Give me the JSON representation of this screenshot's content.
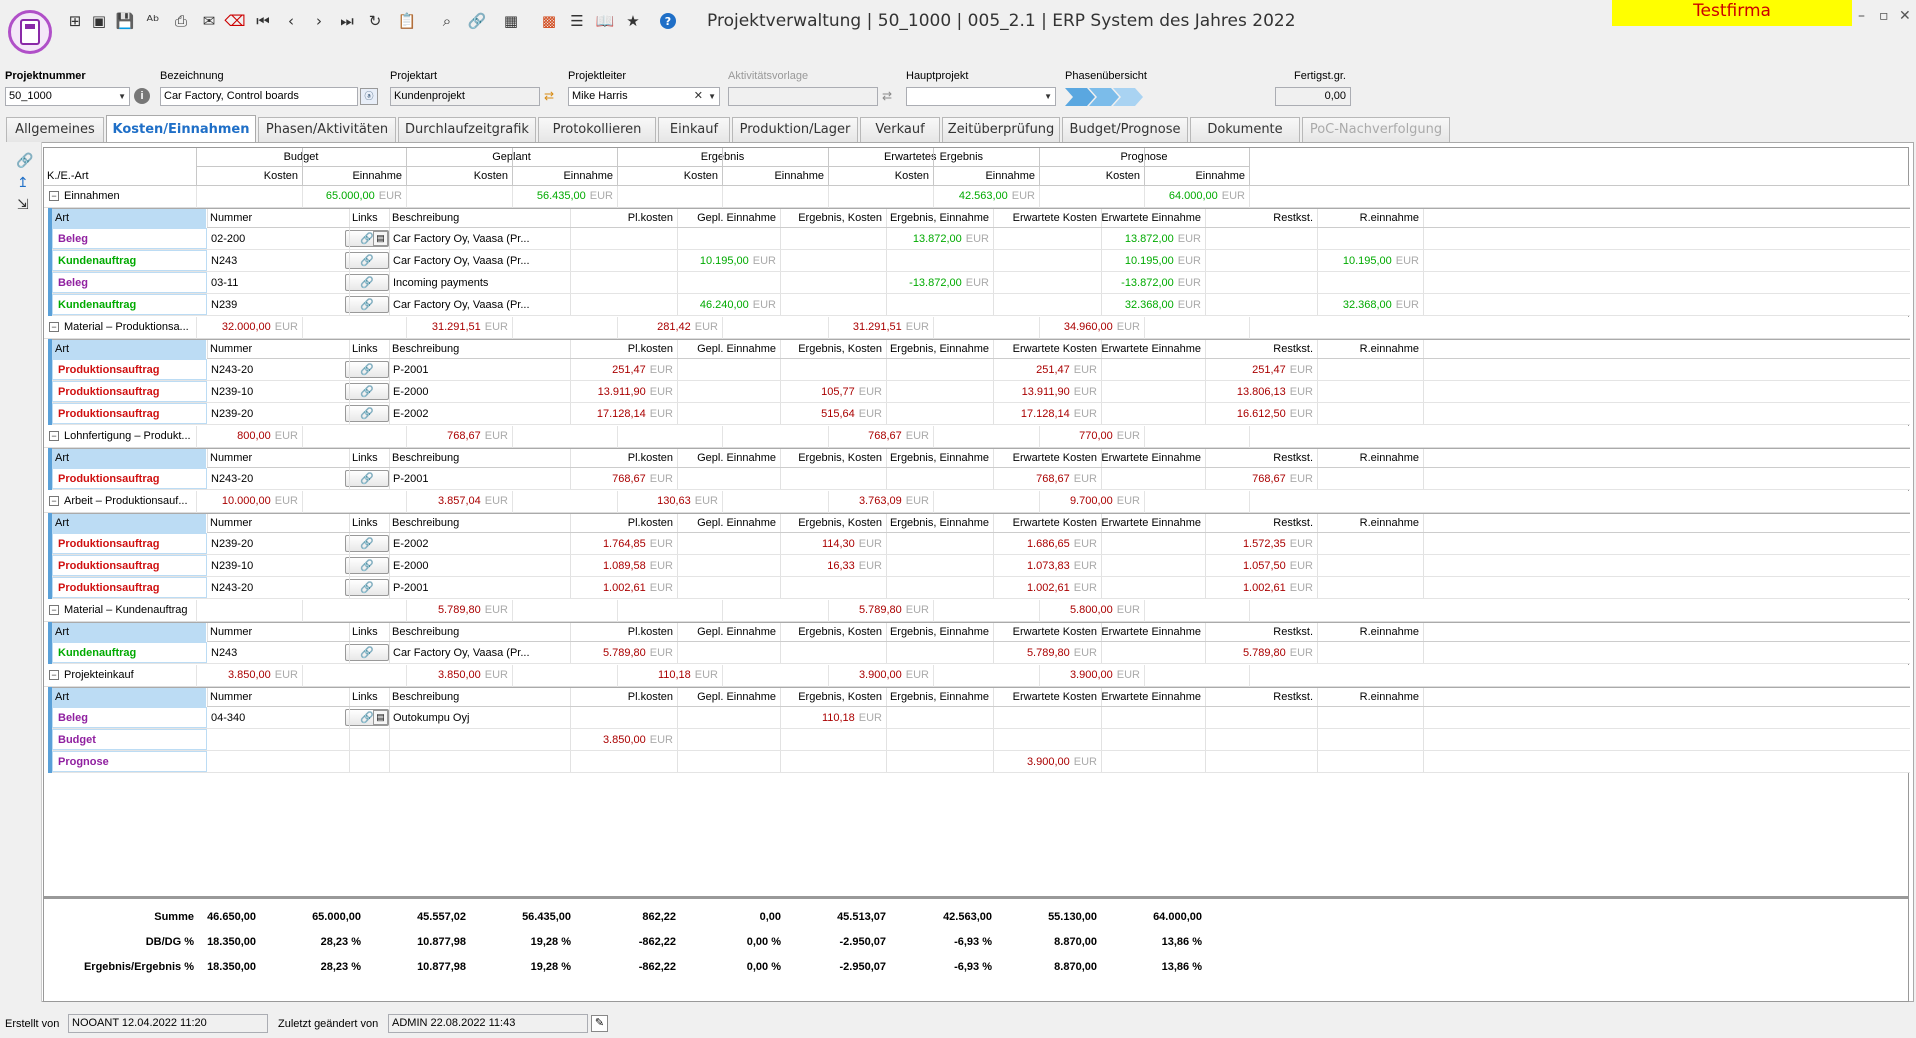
{
  "window": {
    "title": "Projektverwaltung | 50_1000 | 005_2.1 | ERP System des Jahres 2022",
    "company": "Testfirma"
  },
  "toolbar": [
    "new-icon",
    "save-disabled-icon",
    "save-icon",
    "spellcheck-icon",
    "print-icon",
    "mail-icon",
    "delete-icon",
    "first-icon",
    "prev-icon",
    "next-icon",
    "last-icon",
    "refresh-icon",
    "clipboard-icon",
    "search-icon",
    "link-icon",
    "grid-icon",
    "apps-icon",
    "list-icon",
    "book-icon",
    "star-icon",
    "help-icon"
  ],
  "fields": {
    "projektnummer": {
      "label": "Projektnummer",
      "value": "50_1000"
    },
    "bezeichnung": {
      "label": "Bezeichnung",
      "value": "Car Factory, Control boards"
    },
    "projektart": {
      "label": "Projektart",
      "value": "Kundenprojekt"
    },
    "projektleiter": {
      "label": "Projektleiter",
      "value": "Mike Harris"
    },
    "aktivitaetsvorlage": {
      "label": "Aktivitätsvorlage",
      "value": ""
    },
    "hauptprojekt": {
      "label": "Hauptprojekt",
      "value": ""
    },
    "phasenuebersicht": {
      "label": "Phasenübersicht"
    },
    "fertigst": {
      "label": "Fertigst.gr.",
      "value": "0,00"
    }
  },
  "tabs": [
    "Allgemeines",
    "Kosten/Einnahmen",
    "Phasen/Aktivitäten",
    "Durchlaufzeitgrafik",
    "Protokollieren",
    "Einkauf",
    "Produktion/Lager",
    "Verkauf",
    "Zeitüberprüfung",
    "Budget/Prognose",
    "Dokumente",
    "PoC-Nachverfolgung"
  ],
  "grid": {
    "col_kea": "K./E.-Art",
    "groups_hdr": [
      "Budget",
      "Geplant",
      "Ergebnis",
      "Erwartetes Ergebnis",
      "Prognose"
    ],
    "kosten": "Kosten",
    "einnahme": "Einnahme",
    "eur": "EUR",
    "sub_headers": [
      "Art",
      "Nummer",
      "Links",
      "Beschreibung",
      "Pl.kosten",
      "Gepl. Einnahme",
      "Ergebnis, Kosten",
      "Ergebnis, Einnahme",
      "Erwartete Kosten",
      "Erwartete Einnahme",
      "Restkst.",
      "R.einnahme"
    ],
    "sections": [
      {
        "name": "Einnahmen",
        "vals": [
          "",
          "65.000,00",
          "",
          "56.435,00",
          "",
          "",
          "",
          "42.563,00",
          "",
          "64.000,00"
        ],
        "rows": [
          {
            "art": "Beleg",
            "cls": "pur",
            "nr": "02-200",
            "doc": true,
            "desc": "Car Factory Oy, Vaasa (Pr...",
            "v": [
              "",
              "",
              "",
              "13.872,00",
              "",
              "13.872,00",
              "",
              ""
            ],
            "vc": "grn"
          },
          {
            "art": "Kundenauftrag",
            "cls": "grn",
            "nr": "N243",
            "doc": false,
            "desc": "Car Factory Oy, Vaasa (Pr...",
            "v": [
              "",
              "10.195,00",
              "",
              "",
              "",
              "10.195,00",
              "",
              "10.195,00"
            ],
            "vc": "grn"
          },
          {
            "art": "Beleg",
            "cls": "pur",
            "nr": "03-11",
            "doc": false,
            "desc": "Incoming payments",
            "v": [
              "",
              "",
              "",
              "-13.872,00",
              "",
              "-13.872,00",
              "",
              ""
            ],
            "vc": "grn"
          },
          {
            "art": "Kundenauftrag",
            "cls": "grn",
            "nr": "N239",
            "doc": false,
            "desc": "Car Factory Oy, Vaasa (Pr...",
            "v": [
              "",
              "46.240,00",
              "",
              "",
              "",
              "32.368,00",
              "",
              "32.368,00"
            ],
            "vc": "grn"
          }
        ]
      },
      {
        "name": "Material – Produktionsa...",
        "vals": [
          "32.000,00",
          "",
          "31.291,51",
          "",
          "281,42",
          "",
          "31.291,51",
          "",
          "34.960,00",
          ""
        ],
        "rows": [
          {
            "art": "Produktionsauftrag",
            "cls": "redb",
            "nr": "N243-20",
            "doc": false,
            "desc": "P-2001",
            "v": [
              "251,47",
              "",
              "",
              "",
              "251,47",
              "",
              "251,47",
              ""
            ],
            "vc": "red"
          },
          {
            "art": "Produktionsauftrag",
            "cls": "redb",
            "nr": "N239-10",
            "doc": false,
            "desc": "E-2000",
            "v": [
              "13.911,90",
              "",
              "105,77",
              "",
              "13.911,90",
              "",
              "13.806,13",
              ""
            ],
            "vc": "red"
          },
          {
            "art": "Produktionsauftrag",
            "cls": "redb",
            "nr": "N239-20",
            "doc": false,
            "desc": "E-2002",
            "v": [
              "17.128,14",
              "",
              "515,64",
              "",
              "17.128,14",
              "",
              "16.612,50",
              ""
            ],
            "vc": "red"
          }
        ]
      },
      {
        "name": "Lohnfertigung – Produkt...",
        "vals": [
          "800,00",
          "",
          "768,67",
          "",
          "",
          "",
          "768,67",
          "",
          "770,00",
          ""
        ],
        "rows": [
          {
            "art": "Produktionsauftrag",
            "cls": "redb",
            "nr": "N243-20",
            "doc": false,
            "desc": "P-2001",
            "v": [
              "768,67",
              "",
              "",
              "",
              "768,67",
              "",
              "768,67",
              ""
            ],
            "vc": "red"
          }
        ]
      },
      {
        "name": "Arbeit – Produktionsauf...",
        "vals": [
          "10.000,00",
          "",
          "3.857,04",
          "",
          "130,63",
          "",
          "3.763,09",
          "",
          "9.700,00",
          ""
        ],
        "rows": [
          {
            "art": "Produktionsauftrag",
            "cls": "redb",
            "nr": "N239-20",
            "doc": false,
            "desc": "E-2002",
            "v": [
              "1.764,85",
              "",
              "114,30",
              "",
              "1.686,65",
              "",
              "1.572,35",
              ""
            ],
            "vc": "red"
          },
          {
            "art": "Produktionsauftrag",
            "cls": "redb",
            "nr": "N239-10",
            "doc": false,
            "desc": "E-2000",
            "v": [
              "1.089,58",
              "",
              "16,33",
              "",
              "1.073,83",
              "",
              "1.057,50",
              ""
            ],
            "vc": "red"
          },
          {
            "art": "Produktionsauftrag",
            "cls": "redb",
            "nr": "N243-20",
            "doc": false,
            "desc": "P-2001",
            "v": [
              "1.002,61",
              "",
              "",
              "",
              "1.002,61",
              "",
              "1.002,61",
              ""
            ],
            "vc": "red"
          }
        ]
      },
      {
        "name": "Material – Kundenauftrag",
        "vals": [
          "",
          "",
          "5.789,80",
          "",
          "",
          "",
          "5.789,80",
          "",
          "5.800,00",
          ""
        ],
        "rows": [
          {
            "art": "Kundenauftrag",
            "cls": "grn",
            "nr": "N243",
            "doc": false,
            "desc": "Car Factory Oy, Vaasa (Pr...",
            "v": [
              "5.789,80",
              "",
              "",
              "",
              "5.789,80",
              "",
              "5.789,80",
              ""
            ],
            "vc": "red"
          }
        ]
      },
      {
        "name": "Projekteinkauf",
        "vals": [
          "3.850,00",
          "",
          "3.850,00",
          "",
          "110,18",
          "",
          "3.900,00",
          "",
          "3.900,00",
          ""
        ],
        "rows": [
          {
            "art": "Beleg",
            "cls": "pur",
            "nr": "04-340",
            "doc": true,
            "desc": "Outokumpu Oyj",
            "v": [
              "",
              "",
              "110,18",
              "",
              "",
              "",
              "",
              ""
            ],
            "vc": "red",
            "link": true
          },
          {
            "art": "Budget",
            "cls": "pur",
            "nr": "",
            "doc": false,
            "desc": "",
            "v": [
              "3.850,00",
              "",
              "",
              "",
              "",
              "",
              "",
              ""
            ],
            "vc": "red",
            "link": false
          },
          {
            "art": "Prognose",
            "cls": "pur",
            "nr": "",
            "doc": false,
            "desc": "",
            "v": [
              "",
              "",
              "",
              "",
              "3.900,00",
              "",
              "",
              ""
            ],
            "vc": "red",
            "link": false
          }
        ]
      }
    ]
  },
  "sums": [
    {
      "label": "Summe",
      "v": [
        "46.650,00",
        "65.000,00",
        "45.557,02",
        "56.435,00",
        "862,22",
        "0,00",
        "45.513,07",
        "42.563,00",
        "55.130,00",
        "64.000,00"
      ]
    },
    {
      "label": "DB/DG %",
      "v": [
        "18.350,00",
        "28,23 %",
        "10.877,98",
        "19,28 %",
        "-862,22",
        "0,00 %",
        "-2.950,07",
        "-6,93 %",
        "8.870,00",
        "13,86 %"
      ]
    },
    {
      "label": "Ergebnis/Ergebnis %",
      "v": [
        "18.350,00",
        "28,23 %",
        "10.877,98",
        "19,28 %",
        "-862,22",
        "0,00 %",
        "-2.950,07",
        "-6,93 %",
        "8.870,00",
        "13,86 %"
      ]
    }
  ],
  "footer": {
    "erstellt_label": "Erstellt von",
    "erstellt_value": "NOOANT 12.04.2022 11:20",
    "geaendert_label": "Zuletzt geändert von",
    "geaendert_value": "ADMIN 22.08.2022 11:43"
  }
}
